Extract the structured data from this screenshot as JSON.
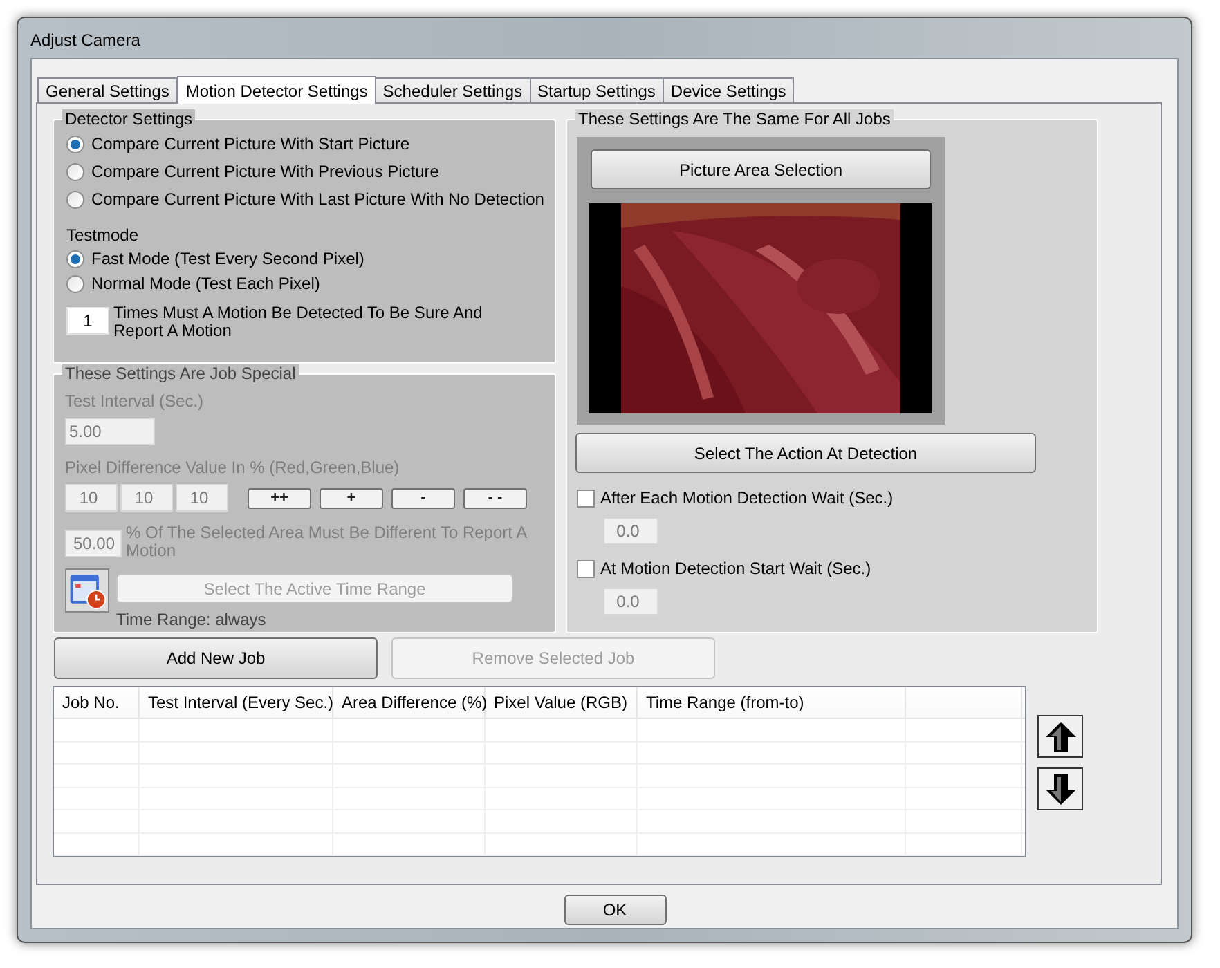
{
  "window": {
    "title": "Adjust Camera"
  },
  "tabs": [
    {
      "label": "General Settings",
      "selected": false
    },
    {
      "label": "Motion Detector Settings",
      "selected": true
    },
    {
      "label": "Scheduler Settings",
      "selected": false
    },
    {
      "label": "Startup Settings",
      "selected": false
    },
    {
      "label": "Device Settings",
      "selected": false
    }
  ],
  "detector_settings": {
    "title": "Detector Settings",
    "compare_options": [
      {
        "label": "Compare Current Picture With Start Picture",
        "selected": true
      },
      {
        "label": "Compare Current Picture With Previous Picture",
        "selected": false
      },
      {
        "label": "Compare Current Picture With Last Picture With No Detection",
        "selected": false
      }
    ],
    "testmode_label": "Testmode",
    "testmode_options": [
      {
        "label": "Fast Mode (Test Every Second Pixel)",
        "selected": true
      },
      {
        "label": "Normal Mode (Test Each Pixel)",
        "selected": false
      }
    ],
    "times_value": "1",
    "times_label": "Times Must A Motion Be Detected To Be Sure And Report A Motion"
  },
  "job_special": {
    "title": "These Settings Are Job Special",
    "disabled": true,
    "interval_label": "Test Interval (Sec.)",
    "interval_value": "5.00",
    "pixel_label": "Pixel Difference Value In % (Red,Green,Blue)",
    "pixel_values": [
      "10",
      "10",
      "10"
    ],
    "step_buttons": [
      "++",
      "+",
      "-",
      "- -"
    ],
    "area_value": "50.00",
    "area_label": "% Of The Selected Area Must Be Different To Report A Motion",
    "time_range_button": {
      "label": "Select The Active Time Range",
      "disabled": true
    },
    "time_range_text": "Time Range: always"
  },
  "all_jobs": {
    "title": "These Settings Are The Same For All Jobs",
    "picture_area_button": "Picture Area Selection",
    "action_button": "Select The Action At Detection",
    "waits": [
      {
        "label": "After Each Motion Detection Wait (Sec.)",
        "checked": false,
        "value": "0.0"
      },
      {
        "label": "At Motion Detection Start Wait (Sec.)",
        "checked": false,
        "value": "0.0"
      }
    ]
  },
  "job_buttons": [
    {
      "label": "Add New Job",
      "disabled": false
    },
    {
      "label": "Remove Selected Job",
      "disabled": true
    }
  ],
  "table": {
    "columns": [
      "Job No.",
      "Test Interval (Every Sec.)",
      "Area Difference (%)",
      "Pixel Value (RGB)",
      "Time Range (from-to)"
    ]
  },
  "ok_button": "OK"
}
